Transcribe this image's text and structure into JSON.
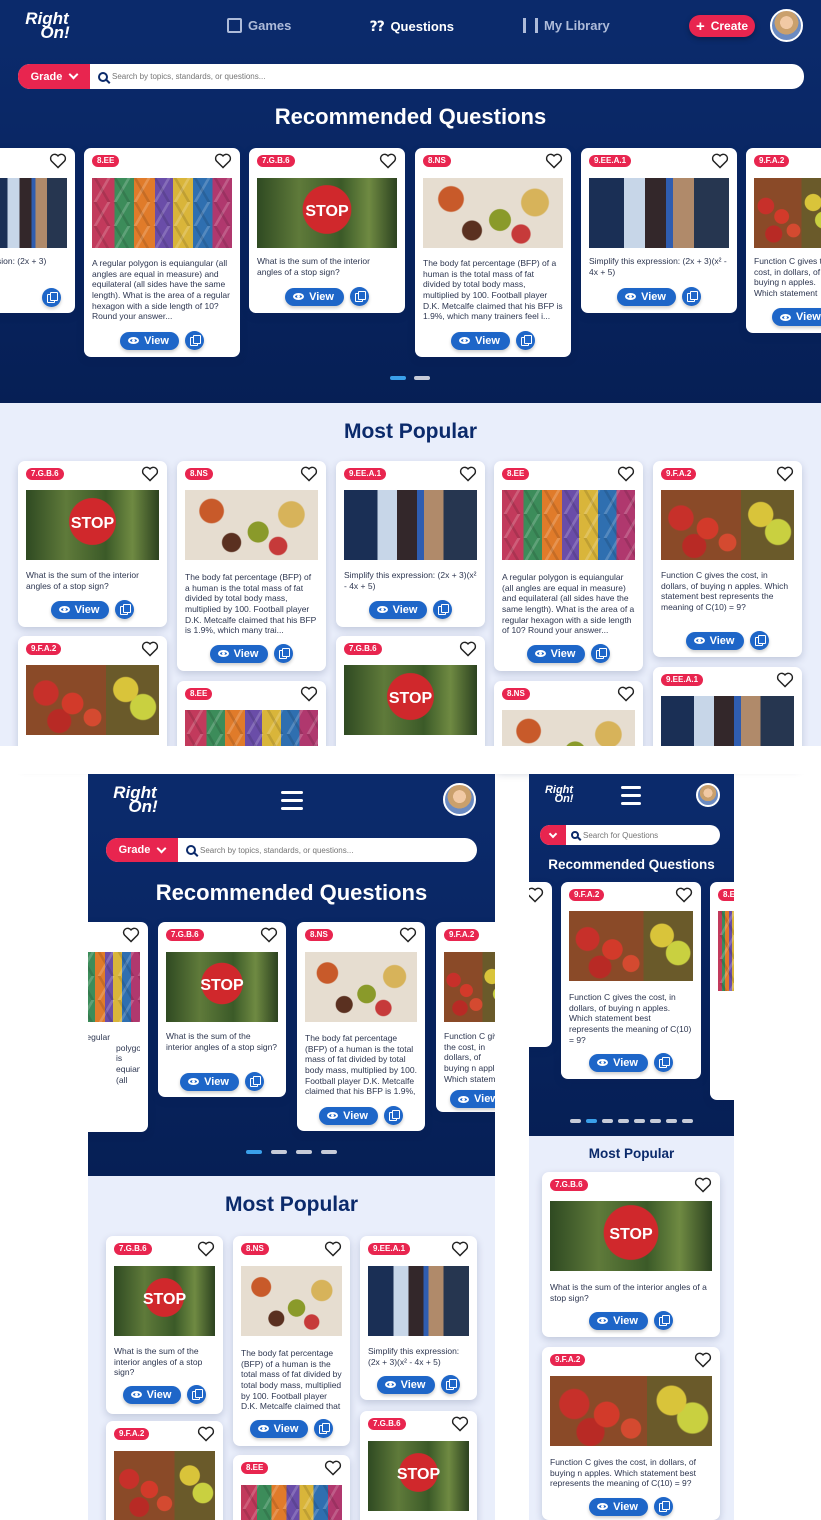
{
  "brand": {
    "logo_top": "Right",
    "logo_bottom": "On!"
  },
  "nav": {
    "games": "Games",
    "questions": "Questions",
    "library": "My Library",
    "create": "Create"
  },
  "search": {
    "grade": "Grade",
    "placeholder": "Search by topics, standards, or questions...",
    "placeholder_mobile": "Search for Questions"
  },
  "sections": {
    "recommended": "Recommended Questions",
    "popular": "Most Popular"
  },
  "view_label": "View",
  "questions": {
    "q_ee": {
      "tag": "8.EE",
      "text": "A regular polygon is equiangular (all angles are equal in measure) and equilateral (all sides have the same length). What is the area of a regular hexagon with a side length of 10? Round your answer..."
    },
    "q_stop": {
      "tag": "7.G.B.6",
      "text": "What is the sum of the interior angles of a stop sign?"
    },
    "q_ns": {
      "tag": "8.NS",
      "text": "The body fat percentage (BFP) of a human is the total mass of fat divided by total body mass, multiplied by 100. Football player D.K. Metcalfe claimed that his BFP is 1.9%, which many trainers feel i..."
    },
    "q_ns_short": {
      "tag": "8.NS",
      "text": "The body fat percentage (BFP) of a human is the total mass of fat divided by total body mass, multiplied by 100. Football player D.K. Metcalfe claimed that his BFP is 1.9%, which many trai..."
    },
    "q_alg": {
      "tag": "9.EE.A.1",
      "text": "Simplify this expression: (2x + 3)(x² - 4x + 5)"
    },
    "q_apple": {
      "tag": "9.F.A.2",
      "text": "Function C gives the cost, in dollars, of buying n apples. Which statement best represents the meaning of C(10) = 9?"
    },
    "q_alg_cut": {
      "text": "ession: (2x + 3)"
    },
    "q_apple_cut": {
      "text": "Function C gives the cost, in dollars, of buying n apples. Which statement best represents the meaning of C(10) = 9?"
    },
    "stop_sign": "STOP"
  },
  "colors": {
    "navy": "#0b2a6b",
    "accent": "#e8254f",
    "button": "#1e66c8",
    "dot_active": "#3aa0ea",
    "lavender": "#e9eefb"
  }
}
